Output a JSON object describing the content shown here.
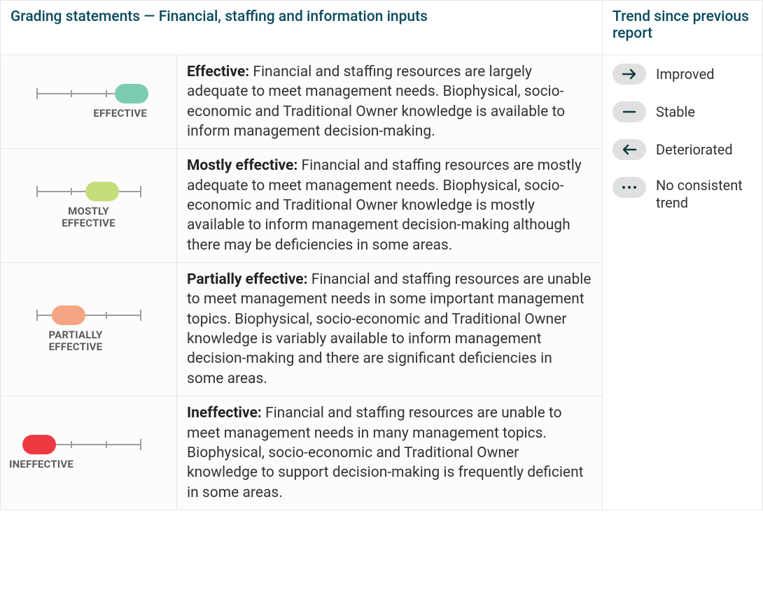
{
  "header": {
    "left_title": "Grading statements — Financial, staffing and information inputs",
    "right_title": "Trend since previous report"
  },
  "grades": [
    {
      "label": "EFFECTIVE",
      "term": "Effective:",
      "desc": " Financial and staffing resources are largely adequate to meet management needs. Biophysical, socio-economic and Traditional Owner knowledge is available to inform management decision-making."
    },
    {
      "label": "MOSTLY EFFECTIVE",
      "term": "Mostly effective:",
      "desc": " Financial and staffing resources are mostly adequate to meet management needs. Biophysical, socio-economic and Traditional Owner knowledge is mostly available to inform management decision-making although there may be deficiencies in some areas."
    },
    {
      "label": "PARTIALLY EFFECTIVE",
      "term": "Partially effective:",
      "desc": " Financial and staffing resources are unable to meet management needs in some important management topics. Biophysical, socio-economic and Traditional Owner knowledge is variably available to inform management decision-making and there are significant deficiencies in some areas."
    },
    {
      "label": "INEFFECTIVE",
      "term": "Ineffective:",
      "desc": " Financial and staffing resources are unable to meet management needs in many management topics. Biophysical, socio-economic and Traditional Owner knowledge to support decision-making is frequently deficient in some areas."
    }
  ],
  "trends": [
    {
      "label": "Improved"
    },
    {
      "label": "Stable"
    },
    {
      "label": "Deteriorated"
    },
    {
      "label": "No consistent trend"
    }
  ]
}
